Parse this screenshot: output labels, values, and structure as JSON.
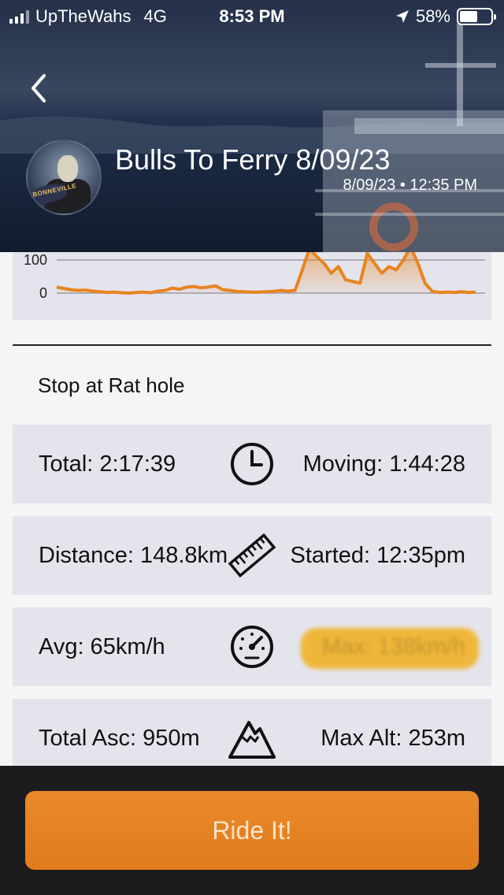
{
  "status_bar": {
    "carrier": "UpTheWahs",
    "network": "4G",
    "time": "8:53 PM",
    "battery": "58%",
    "battery_fraction": 0.58
  },
  "header": {
    "title": "Bulls To Ferry 8/09/23",
    "datetime": "8/09/23 • 12:35 PM",
    "avatar_text": "BONNEVILLE"
  },
  "chart_data": {
    "type": "area",
    "series": [
      {
        "color": "#e8841f",
        "values": [
          18,
          14,
          10,
          8,
          9,
          6,
          4,
          2,
          3,
          1,
          0,
          2,
          3,
          1,
          6,
          8,
          15,
          12,
          18,
          20,
          16,
          18,
          22,
          10,
          8,
          5,
          4,
          3,
          3,
          4,
          5,
          8,
          6,
          8,
          70,
          135,
          110,
          90,
          60,
          80,
          40,
          35,
          30,
          120,
          90,
          60,
          80,
          70,
          100,
          140,
          90,
          30,
          5,
          2,
          3,
          2,
          4,
          2,
          3
        ]
      }
    ],
    "ylim": [
      0,
      140
    ],
    "yticks": [
      "100",
      "0"
    ],
    "grid": true
  },
  "note": "Stop at Rat hole",
  "stats": [
    {
      "left": "Total: 2:17:39",
      "icon": "clock-icon",
      "right": "Moving: 1:44:28"
    },
    {
      "left": "Distance: 148.8km",
      "icon": "ruler-icon",
      "right": "Started: 12:35pm"
    },
    {
      "left": "Avg: 65km/h",
      "icon": "speedometer-icon",
      "right": "Max: 138km/h"
    },
    {
      "left": "Total Asc: 950m",
      "icon": "mountain-icon",
      "right": "Max Alt: 253m"
    }
  ],
  "action": {
    "ride_label": "Ride It!"
  },
  "colors": {
    "accent": "#e8841f",
    "card": "#e4e4ec",
    "bottom_bar": "#1c1c1f"
  }
}
